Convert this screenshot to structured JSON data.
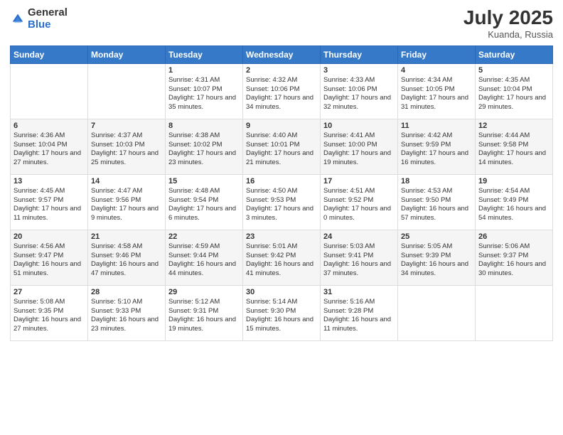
{
  "header": {
    "logo_general": "General",
    "logo_blue": "Blue",
    "month": "July 2025",
    "location": "Kuanda, Russia"
  },
  "days_of_week": [
    "Sunday",
    "Monday",
    "Tuesday",
    "Wednesday",
    "Thursday",
    "Friday",
    "Saturday"
  ],
  "weeks": [
    [
      {
        "num": "",
        "info": ""
      },
      {
        "num": "",
        "info": ""
      },
      {
        "num": "1",
        "info": "Sunrise: 4:31 AM\nSunset: 10:07 PM\nDaylight: 17 hours\nand 35 minutes."
      },
      {
        "num": "2",
        "info": "Sunrise: 4:32 AM\nSunset: 10:06 PM\nDaylight: 17 hours\nand 34 minutes."
      },
      {
        "num": "3",
        "info": "Sunrise: 4:33 AM\nSunset: 10:06 PM\nDaylight: 17 hours\nand 32 minutes."
      },
      {
        "num": "4",
        "info": "Sunrise: 4:34 AM\nSunset: 10:05 PM\nDaylight: 17 hours\nand 31 minutes."
      },
      {
        "num": "5",
        "info": "Sunrise: 4:35 AM\nSunset: 10:04 PM\nDaylight: 17 hours\nand 29 minutes."
      }
    ],
    [
      {
        "num": "6",
        "info": "Sunrise: 4:36 AM\nSunset: 10:04 PM\nDaylight: 17 hours\nand 27 minutes."
      },
      {
        "num": "7",
        "info": "Sunrise: 4:37 AM\nSunset: 10:03 PM\nDaylight: 17 hours\nand 25 minutes."
      },
      {
        "num": "8",
        "info": "Sunrise: 4:38 AM\nSunset: 10:02 PM\nDaylight: 17 hours\nand 23 minutes."
      },
      {
        "num": "9",
        "info": "Sunrise: 4:40 AM\nSunset: 10:01 PM\nDaylight: 17 hours\nand 21 minutes."
      },
      {
        "num": "10",
        "info": "Sunrise: 4:41 AM\nSunset: 10:00 PM\nDaylight: 17 hours\nand 19 minutes."
      },
      {
        "num": "11",
        "info": "Sunrise: 4:42 AM\nSunset: 9:59 PM\nDaylight: 17 hours\nand 16 minutes."
      },
      {
        "num": "12",
        "info": "Sunrise: 4:44 AM\nSunset: 9:58 PM\nDaylight: 17 hours\nand 14 minutes."
      }
    ],
    [
      {
        "num": "13",
        "info": "Sunrise: 4:45 AM\nSunset: 9:57 PM\nDaylight: 17 hours\nand 11 minutes."
      },
      {
        "num": "14",
        "info": "Sunrise: 4:47 AM\nSunset: 9:56 PM\nDaylight: 17 hours\nand 9 minutes."
      },
      {
        "num": "15",
        "info": "Sunrise: 4:48 AM\nSunset: 9:54 PM\nDaylight: 17 hours\nand 6 minutes."
      },
      {
        "num": "16",
        "info": "Sunrise: 4:50 AM\nSunset: 9:53 PM\nDaylight: 17 hours\nand 3 minutes."
      },
      {
        "num": "17",
        "info": "Sunrise: 4:51 AM\nSunset: 9:52 PM\nDaylight: 17 hours\nand 0 minutes."
      },
      {
        "num": "18",
        "info": "Sunrise: 4:53 AM\nSunset: 9:50 PM\nDaylight: 16 hours\nand 57 minutes."
      },
      {
        "num": "19",
        "info": "Sunrise: 4:54 AM\nSunset: 9:49 PM\nDaylight: 16 hours\nand 54 minutes."
      }
    ],
    [
      {
        "num": "20",
        "info": "Sunrise: 4:56 AM\nSunset: 9:47 PM\nDaylight: 16 hours\nand 51 minutes."
      },
      {
        "num": "21",
        "info": "Sunrise: 4:58 AM\nSunset: 9:46 PM\nDaylight: 16 hours\nand 47 minutes."
      },
      {
        "num": "22",
        "info": "Sunrise: 4:59 AM\nSunset: 9:44 PM\nDaylight: 16 hours\nand 44 minutes."
      },
      {
        "num": "23",
        "info": "Sunrise: 5:01 AM\nSunset: 9:42 PM\nDaylight: 16 hours\nand 41 minutes."
      },
      {
        "num": "24",
        "info": "Sunrise: 5:03 AM\nSunset: 9:41 PM\nDaylight: 16 hours\nand 37 minutes."
      },
      {
        "num": "25",
        "info": "Sunrise: 5:05 AM\nSunset: 9:39 PM\nDaylight: 16 hours\nand 34 minutes."
      },
      {
        "num": "26",
        "info": "Sunrise: 5:06 AM\nSunset: 9:37 PM\nDaylight: 16 hours\nand 30 minutes."
      }
    ],
    [
      {
        "num": "27",
        "info": "Sunrise: 5:08 AM\nSunset: 9:35 PM\nDaylight: 16 hours\nand 27 minutes."
      },
      {
        "num": "28",
        "info": "Sunrise: 5:10 AM\nSunset: 9:33 PM\nDaylight: 16 hours\nand 23 minutes."
      },
      {
        "num": "29",
        "info": "Sunrise: 5:12 AM\nSunset: 9:31 PM\nDaylight: 16 hours\nand 19 minutes."
      },
      {
        "num": "30",
        "info": "Sunrise: 5:14 AM\nSunset: 9:30 PM\nDaylight: 16 hours\nand 15 minutes."
      },
      {
        "num": "31",
        "info": "Sunrise: 5:16 AM\nSunset: 9:28 PM\nDaylight: 16 hours\nand 11 minutes."
      },
      {
        "num": "",
        "info": ""
      },
      {
        "num": "",
        "info": ""
      }
    ]
  ]
}
